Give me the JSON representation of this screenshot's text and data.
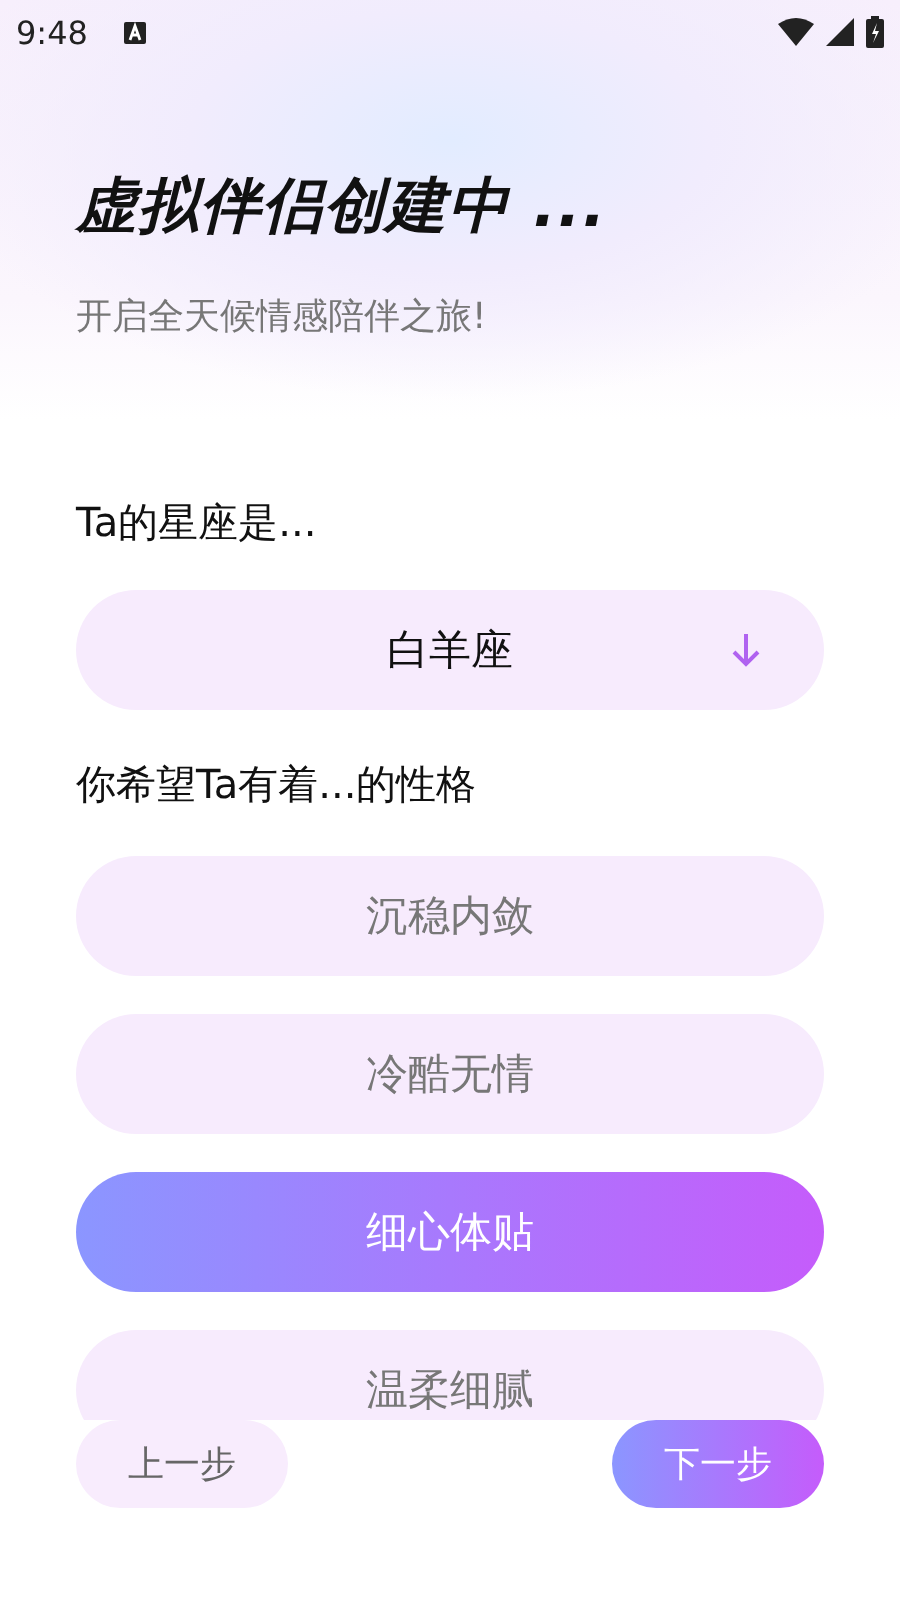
{
  "status_bar": {
    "time": "9:48"
  },
  "header": {
    "title": "虚拟伴侣创建中 ...",
    "subtitle": "开启全天候情感陪伴之旅!"
  },
  "zodiac": {
    "label": "Ta的星座是...",
    "value": "白羊座"
  },
  "personality": {
    "label": "你希望Ta有着...的性格",
    "options": [
      {
        "label": "沉稳内敛",
        "selected": false
      },
      {
        "label": "冷酷无情",
        "selected": false
      },
      {
        "label": "细心体贴",
        "selected": true
      },
      {
        "label": "温柔细腻",
        "selected": false
      }
    ]
  },
  "buttons": {
    "back": "上一步",
    "next": "下一步"
  }
}
